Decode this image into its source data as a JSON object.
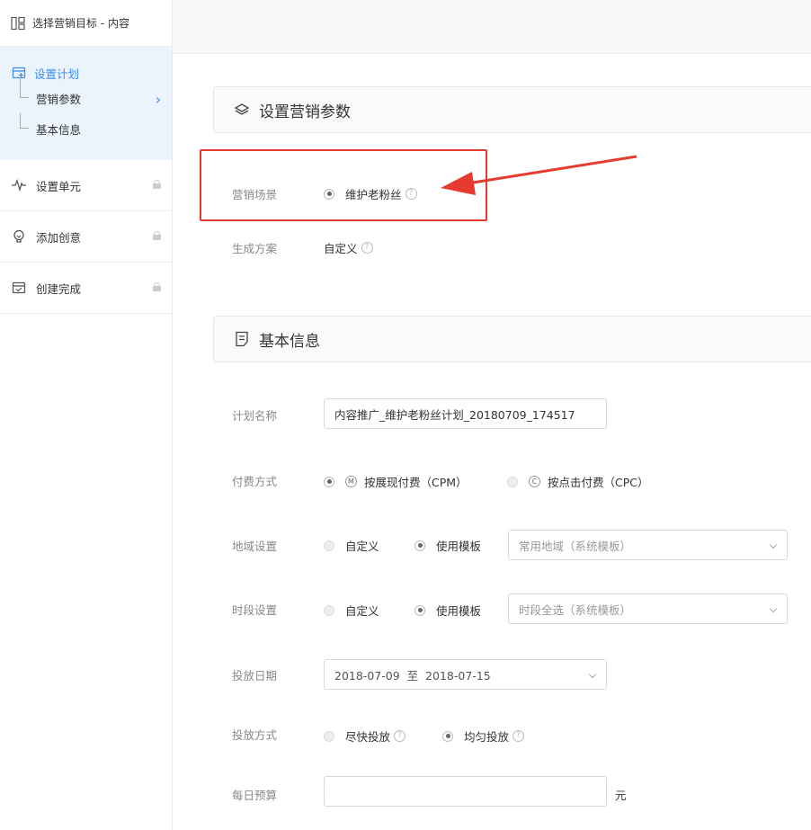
{
  "sidebar": {
    "target": "选择营销目标 - 内容",
    "active": {
      "title": "设置计划",
      "subs": [
        "营销参数",
        "基本信息"
      ]
    },
    "items": [
      "设置单元",
      "添加创意",
      "创建完成"
    ]
  },
  "sections": {
    "marketing": "设置营销参数",
    "basic": "基本信息"
  },
  "marketing_params": {
    "scene_label": "营销场景",
    "scene_value": "维护老粉丝",
    "plan_label": "生成方案",
    "plan_value": "自定义"
  },
  "basic_info": {
    "name_label": "计划名称",
    "name_value": "内容推广_维护老粉丝计划_20180709_174517",
    "pay_label": "付费方式",
    "pay_cpm_letter": "M",
    "pay_cpm": "按展现付费（CPM）",
    "pay_cpc_letter": "C",
    "pay_cpc": "按点击付费（CPC）",
    "region_label": "地域设置",
    "region_custom": "自定义",
    "region_template": "使用模板",
    "region_select": "常用地域（系统模板）",
    "time_label": "时段设置",
    "time_custom": "自定义",
    "time_template": "使用模板",
    "time_select": "时段全选（系统模板）",
    "date_label": "投放日期",
    "date_value": "2018-07-09  至  2018-07-15",
    "mode_label": "投放方式",
    "mode_fast": "尽快投放",
    "mode_even": "均匀投放",
    "budget_label": "每日预算",
    "budget_value": "",
    "budget_unit": "元"
  },
  "colors": {
    "accent": "#3b8ef0",
    "highlight": "#e63b2e",
    "active_bg": "#ebf3fd"
  }
}
